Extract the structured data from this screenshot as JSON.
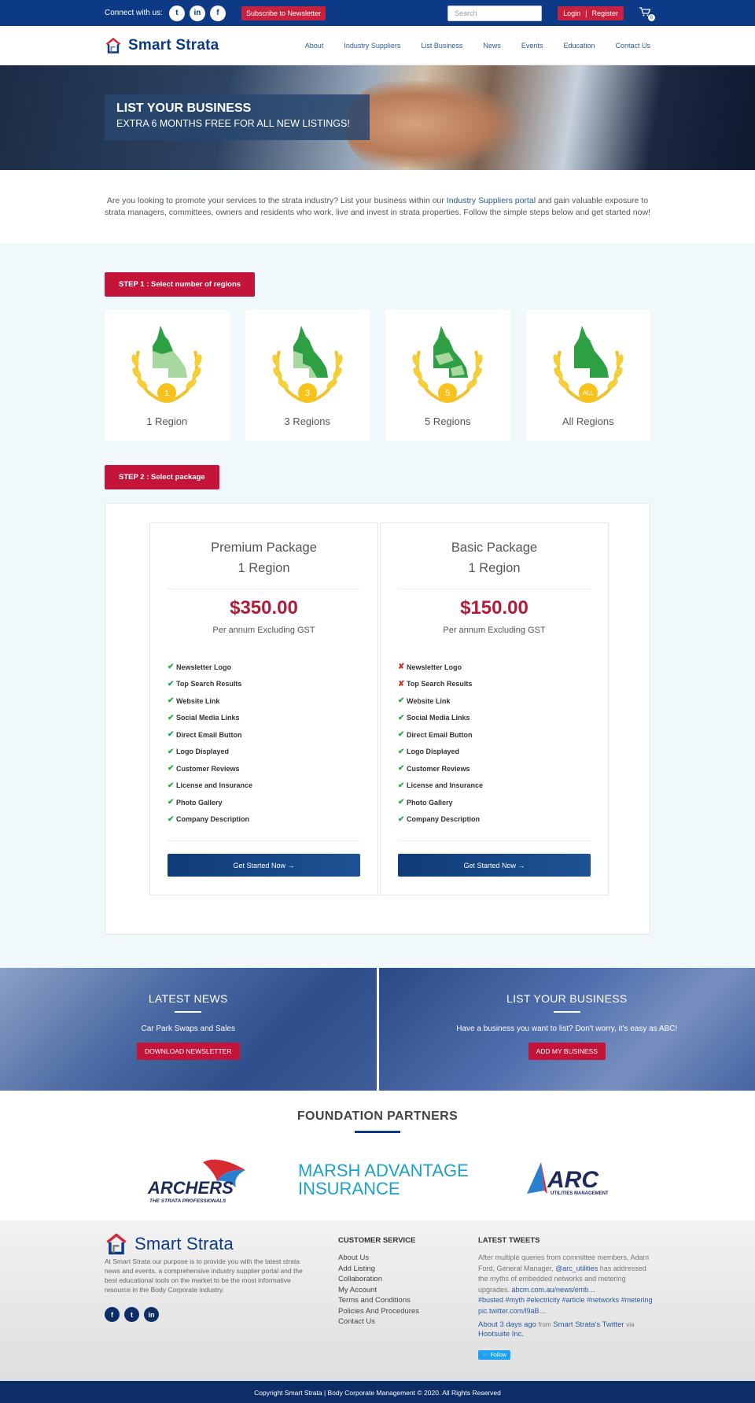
{
  "topbar": {
    "connect": "Connect with us:",
    "social": [
      "twitter-icon",
      "linkedin-icon",
      "facebook-icon"
    ],
    "subscribe": "Subscribe to Newsletter",
    "search_placeholder": "Search",
    "login": "Login",
    "separator": "|",
    "register": "Register",
    "cart_count": "0"
  },
  "header": {
    "logo_text": "Smart Strata",
    "nav": [
      "About",
      "Industry Suppliers",
      "List Business",
      "News",
      "Events",
      "Education",
      "Contact Us"
    ]
  },
  "hero": {
    "title": "LIST YOUR BUSINESS",
    "subtitle": "EXTRA 6 MONTHS FREE FOR ALL NEW LISTINGS!"
  },
  "intro": {
    "before": "Are you looking to promote your services to the strata industry? List your business within our ",
    "link": "Industry Suppliers portal",
    "after": " and gain valuable exposure to strata managers, committees, owners and residents who work, live and invest in strata properties. Follow the simple steps below and get started now!"
  },
  "step1": {
    "label": "STEP 1 : Select number of regions",
    "regions": [
      {
        "badge": "1",
        "label": "1 Region"
      },
      {
        "badge": "3",
        "label": "3 Regions"
      },
      {
        "badge": "5",
        "label": "5 Regions"
      },
      {
        "badge": "ALL",
        "label": "All Regions"
      }
    ]
  },
  "step2": {
    "label": "STEP 2 : Select package",
    "packages": [
      {
        "name": "Premium Package",
        "region": "1 Region",
        "price": "$350.00",
        "per": "Per annum Excluding GST",
        "features": [
          {
            "label": "Newsletter Logo",
            "included": true
          },
          {
            "label": "Top Search Results",
            "included": true
          },
          {
            "label": "Website Link",
            "included": true
          },
          {
            "label": "Social Media Links",
            "included": true
          },
          {
            "label": "Direct Email Button",
            "included": true
          },
          {
            "label": "Logo Displayed",
            "included": true
          },
          {
            "label": "Customer Reviews",
            "included": true
          },
          {
            "label": "License and Insurance",
            "included": true
          },
          {
            "label": "Photo Gallery",
            "included": true
          },
          {
            "label": "Company Description",
            "included": true
          }
        ],
        "cta": "Get Started Now →"
      },
      {
        "name": "Basic Package",
        "region": "1 Region",
        "price": "$150.00",
        "per": "Per annum Excluding GST",
        "features": [
          {
            "label": "Newsletter Logo",
            "included": false
          },
          {
            "label": "Top Search Results",
            "included": false
          },
          {
            "label": "Website Link",
            "included": true
          },
          {
            "label": "Social Media Links",
            "included": true
          },
          {
            "label": "Direct Email Button",
            "included": true
          },
          {
            "label": "Logo Displayed",
            "included": true
          },
          {
            "label": "Customer Reviews",
            "included": true
          },
          {
            "label": "License and Insurance",
            "included": true
          },
          {
            "label": "Photo Gallery",
            "included": true
          },
          {
            "label": "Company Description",
            "included": true
          }
        ],
        "cta": "Get Started Now →"
      }
    ]
  },
  "promo": {
    "news": {
      "title": "LATEST NEWS",
      "text": "Car Park Swaps and Sales",
      "button": "DOWNLOAD NEWSLETTER"
    },
    "list": {
      "title": "LIST YOUR BUSINESS",
      "text": "Have a business you want to list? Don't worry, it's easy as ABC!",
      "button": "ADD MY BUSINESS"
    }
  },
  "partners": {
    "title": "FOUNDATION PARTNERS",
    "archers": {
      "name": "ARCHERS",
      "tag": "THE STRATA PROFESSIONALS"
    },
    "marsh": {
      "line1": "MARSH ADVANTAGE",
      "line2": "INSURANCE"
    },
    "arc": {
      "name": "ARC",
      "tag": "UTILITIES MANAGEMENT"
    }
  },
  "footer": {
    "logo_text": "Smart Strata",
    "description": "At Smart Strata our purpose is to provide you with the latest strata news and events, a comprehensive industry supplier portal and the best educational tools on the market to be the most informative resource in the Body Corporate industry.",
    "social": [
      "facebook-icon",
      "twitter-icon",
      "linkedin-icon"
    ],
    "service_title": "CUSTOMER SERVICE",
    "service_links": [
      "About Us",
      "Add Listing",
      "Collaboration",
      "My Account",
      "Terms and Conditions",
      "Policies And Procedures",
      "Contact Us"
    ],
    "tweets_title": "LATEST TWEETS",
    "tweet_text1": "After multiple queries from committee members, Adam Ford, General Manager, ",
    "tweet_mention": "@arc_utilities",
    "tweet_text2": " has addressed the myths of embedded networks and metering upgrades. ",
    "tweet_link": "abcm.com.au/news/emb…",
    "tweet_tags": "#busted #myth #electricity #article #networks #metering pic.twitter.com/l9aB…",
    "tweet_time": "About 3 days ago",
    "tweet_from": "from",
    "tweet_source": "Smart Strata's Twitter",
    "tweet_via": "via",
    "tweet_client": "Hootsuite Inc.",
    "follow": "Follow",
    "copyright": "Copyright Smart Strata | Body Corporate Management © 2020. All Rights Reserved"
  },
  "colors": {
    "navy": "#0c3a86",
    "red": "#c4143a",
    "price": "#b31b3b",
    "check": "#28a745"
  }
}
